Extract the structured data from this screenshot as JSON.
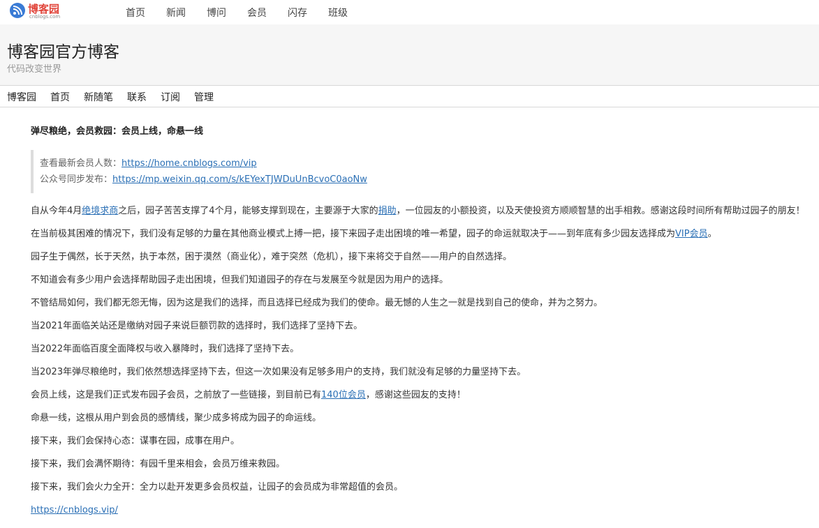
{
  "top_nav": {
    "logo_text": "博客园",
    "logo_sub": "cnblogs.com",
    "items": [
      "首页",
      "新闻",
      "博问",
      "会员",
      "闪存",
      "班级"
    ]
  },
  "blog": {
    "title": "博客园官方博客",
    "subtitle": "代码改变世界",
    "nav": [
      "博客园",
      "首页",
      "新随笔",
      "联系",
      "订阅",
      "管理"
    ]
  },
  "post": {
    "title": "弹尽粮绝，会员救园：会员上线，命悬一线",
    "quote": {
      "line1_label": "查看最新会员人数：",
      "line1_link": "https://home.cnblogs.com/vip",
      "line2_label": "公众号同步发布：",
      "line2_link": "https://mp.weixin.qq.com/s/kEYexTJWDuUnBcvoC0aoNw"
    },
    "p1": {
      "a": "自从今年4月",
      "link1": "绝境求商",
      "b": "之后，园子苦苦支撑了4个月，能够支撑到现在，主要源于大家的",
      "link2": "捐助",
      "c": "，一位园友的小额投资，以及天使投资方顺顺智慧的出手相救。感谢这段时间所有帮助过园子的朋友！"
    },
    "p2": {
      "a": "在当前极其困难的情况下，我们没有足够的力量在其他商业模式上搏一把，接下来园子走出困境的唯一希望，园子的命运就取决于——到年底有多少园友选择成为",
      "link": "VIP会员",
      "b": "。"
    },
    "p3": "园子生于偶然，长于天然，执于本然，困于漠然（商业化），难于突然（危机），接下来将交于自然——用户的自然选择。",
    "p4": "不知道会有多少用户会选择帮助园子走出困境，但我们知道园子的存在与发展至今就是因为用户的选择。",
    "p5": "不管结局如何，我们都无怨无悔，因为这是我们的选择，而且选择已经成为我们的使命。最无憾的人生之一就是找到自己的使命，并为之努力。",
    "p6": "当2021年面临关站还是缴纳对园子来说巨额罚款的选择时，我们选择了坚持下去。",
    "p7": "当2022年面临百度全面降权与收入暴降时，我们选择了坚持下去。",
    "p8": "当2023年弹尽粮绝时，我们依然想选择坚持下去，但这一次如果没有足够多用户的支持，我们就没有足够的力量坚持下去。",
    "p9": {
      "a": "会员上线，这是我们正式发布园子会员，之前放了一些链接，到目前已有",
      "link": "140位会员",
      "b": "，感谢这些园友的支持！"
    },
    "p10": "命悬一线，这根从用户到会员的感情线，聚少成多将成为园子的命运线。",
    "p11": "接下来，我们会保持心态：谋事在园，成事在用户。",
    "p12": "接下来，我们会满怀期待：有园千里来相会，会员万维来救园。",
    "p13": "接下来，我们会火力全开：全力以赴开发更多会员权益，让园子的会员成为非常超值的会员。",
    "final_link": "https://cnblogs.vip/"
  },
  "colors": {
    "link": "#2a6fb5",
    "logo": "#e1453b",
    "header_bg": "#f6f6f6",
    "quote_border": "#dddddd"
  }
}
